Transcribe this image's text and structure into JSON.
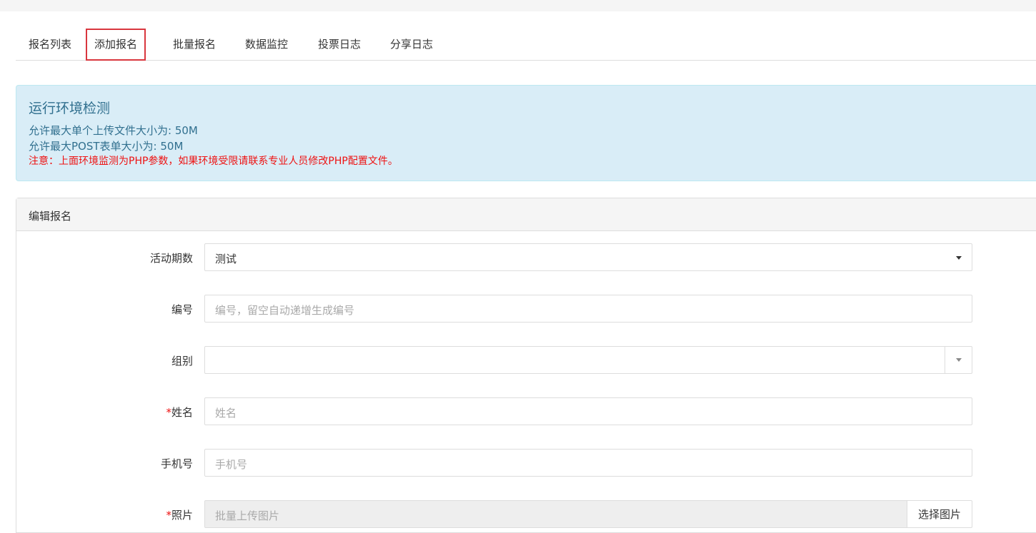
{
  "tabs": [
    {
      "label": "报名列表",
      "active": false
    },
    {
      "label": "添加报名",
      "active": true
    },
    {
      "label": "批量报名",
      "active": false
    },
    {
      "label": "数据监控",
      "active": false
    },
    {
      "label": "投票日志",
      "active": false
    },
    {
      "label": "分享日志",
      "active": false
    }
  ],
  "alert": {
    "title": "运行环境检测",
    "upload_limit": "允许最大单个上传文件大小为: 50M",
    "post_limit": "允许最大POST表单大小为: 50M",
    "note": "注意：上面环境监测为PHP参数，如果环境受限请联系专业人员修改PHP配置文件。"
  },
  "panel": {
    "title": "编辑报名"
  },
  "form": {
    "period": {
      "label": "活动期数",
      "value": "测试"
    },
    "number": {
      "label": "编号",
      "placeholder": "编号，留空自动递增生成编号"
    },
    "group": {
      "label": "组别",
      "value": ""
    },
    "name": {
      "label": "姓名",
      "required_mark": "*",
      "placeholder": "姓名"
    },
    "phone": {
      "label": "手机号",
      "placeholder": "手机号"
    },
    "photo": {
      "label": "照片",
      "required_mark": "*",
      "placeholder": "批量上传图片",
      "button": "选择图片"
    }
  },
  "colors": {
    "accent_tab_border": "#d9363e",
    "alert_bg": "#d9edf7",
    "alert_text": "#31708f",
    "warning_text": "#ee1111"
  }
}
